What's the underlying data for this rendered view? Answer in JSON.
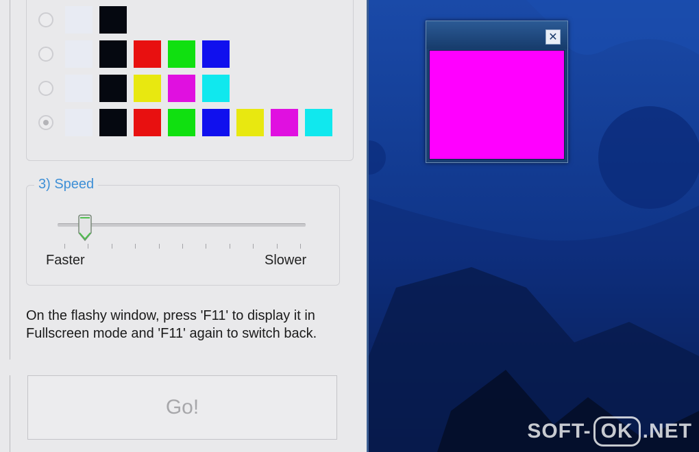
{
  "palette": {
    "rows": [
      {
        "selected": false,
        "colors": [
          "#e8ebf3",
          "#050810"
        ]
      },
      {
        "selected": false,
        "colors": [
          "#e8ebf3",
          "#050810",
          "#e81010",
          "#10e010",
          "#1010ee"
        ]
      },
      {
        "selected": false,
        "colors": [
          "#e8ebf3",
          "#050810",
          "#e8e810",
          "#e010e0",
          "#10e8ee"
        ]
      },
      {
        "selected": true,
        "colors": [
          "#e8ebf3",
          "#050810",
          "#e81010",
          "#10e010",
          "#1010ee",
          "#e8e810",
          "#e010e0",
          "#10e8ee"
        ]
      }
    ]
  },
  "speed": {
    "legend": "3)  Speed",
    "faster_label": "Faster",
    "slower_label": "Slower",
    "value_fraction": 0.11,
    "tick_count": 11
  },
  "info_text": "On the flashy window, press 'F11' to display it in Fullscreen mode and 'F11' again to switch back.",
  "go_button": {
    "label": "Go!",
    "enabled": false
  },
  "flash_window": {
    "fill_color": "#ff00ff",
    "close_glyph": "✕"
  },
  "watermark": {
    "left": "SOFT-",
    "boxed": "OK",
    "right": ".NET"
  },
  "colors": {
    "accent": "#3e8fd6",
    "desktop": "#0b2a6e"
  }
}
